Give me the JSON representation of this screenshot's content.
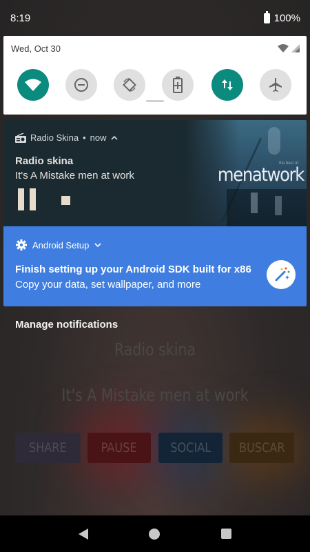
{
  "status_bar": {
    "time": "8:19",
    "battery": "100%"
  },
  "quick_settings": {
    "date": "Wed, Oct 30",
    "tiles": [
      {
        "name": "wifi",
        "state": "on"
      },
      {
        "name": "do-not-disturb",
        "state": "off"
      },
      {
        "name": "auto-rotate",
        "state": "off"
      },
      {
        "name": "battery-saver",
        "state": "off"
      },
      {
        "name": "mobile-data",
        "state": "on"
      },
      {
        "name": "airplane-mode",
        "state": "off"
      }
    ],
    "accent_color": "#0b8a7e"
  },
  "media_notification": {
    "app_name": "Radio Skina",
    "separator": "•",
    "time": "now",
    "title": "Radio skina",
    "subtitle": "It's A Mistake men at work",
    "album_art_text": "menatwork",
    "album_art_small": "the best of"
  },
  "setup_notification": {
    "app_name": "Android Setup",
    "title": "Finish setting up your Android SDK built for x86",
    "subtitle": "Copy your data, set wallpaper, and more",
    "color": "#3f7ee0"
  },
  "manage_notifications": "Manage notifications",
  "background_app": {
    "title": "Radio skina",
    "song": "It's A Mistake men at work",
    "buttons": {
      "share": "SHARE",
      "pause": "PAUSE",
      "social": "SOCIAL",
      "buscar": "BUSCAR"
    }
  }
}
